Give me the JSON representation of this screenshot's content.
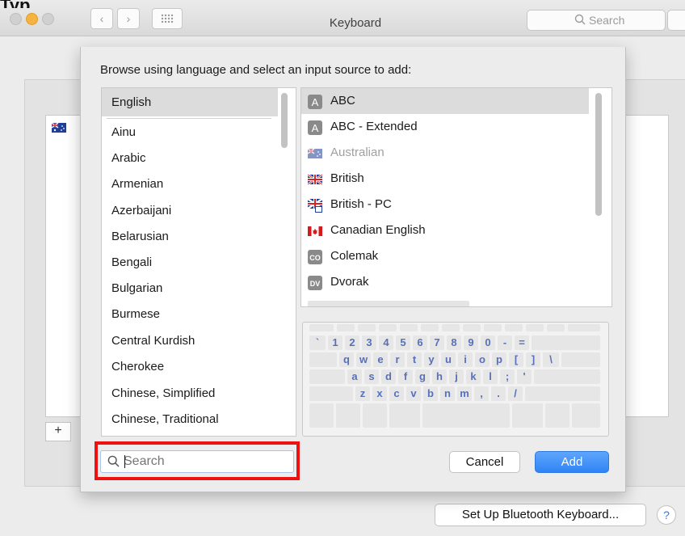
{
  "window": {
    "title": "Keyboard",
    "search_placeholder": "Search",
    "truncated_text": "Typ"
  },
  "sheet": {
    "prompt": "Browse using language and select an input source to add:",
    "languages": [
      {
        "label": "English",
        "selected": true
      },
      {
        "label": "Ainu"
      },
      {
        "label": "Arabic"
      },
      {
        "label": "Armenian"
      },
      {
        "label": "Azerbaijani"
      },
      {
        "label": "Belarusian"
      },
      {
        "label": "Bengali"
      },
      {
        "label": "Bulgarian"
      },
      {
        "label": "Burmese"
      },
      {
        "label": "Central Kurdish"
      },
      {
        "label": "Cherokee"
      },
      {
        "label": "Chinese, Simplified"
      },
      {
        "label": "Chinese, Traditional"
      }
    ],
    "input_sources": [
      {
        "label": "ABC",
        "icon": "letter-a-icon",
        "badge": "A",
        "selected": true
      },
      {
        "label": "ABC - Extended",
        "icon": "letter-a-icon",
        "badge": "A"
      },
      {
        "label": "Australian",
        "icon": "australia-flag-icon",
        "disabled": true
      },
      {
        "label": "British",
        "icon": "uk-flag-icon"
      },
      {
        "label": "British - PC",
        "icon": "uk-flag-pc-icon"
      },
      {
        "label": "Canadian English",
        "icon": "canada-flag-icon"
      },
      {
        "label": "Colemak",
        "icon": "colemak-icon",
        "badge": "CO"
      },
      {
        "label": "Dvorak",
        "icon": "dvorak-icon",
        "badge": "DV"
      }
    ],
    "keyboard_rows": [
      [
        "`",
        "1",
        "2",
        "3",
        "4",
        "5",
        "6",
        "7",
        "8",
        "9",
        "0",
        "-",
        "="
      ],
      [
        "q",
        "w",
        "e",
        "r",
        "t",
        "y",
        "u",
        "i",
        "o",
        "p",
        "[",
        "]",
        "\\"
      ],
      [
        "a",
        "s",
        "d",
        "f",
        "g",
        "h",
        "j",
        "k",
        "l",
        ";",
        "'"
      ],
      [
        "z",
        "x",
        "c",
        "v",
        "b",
        "n",
        "m",
        ",",
        ".",
        "/"
      ]
    ],
    "search": {
      "placeholder": "Search",
      "value": ""
    },
    "cancel_label": "Cancel",
    "add_label": "Add"
  },
  "background": {
    "add_symbol": "+",
    "bluetooth_label": "Set Up Bluetooth Keyboard...",
    "help_symbol": "?"
  },
  "colors": {
    "accent": "#2f84f5",
    "highlight": "#ee1111",
    "key_text": "#5870b8"
  }
}
